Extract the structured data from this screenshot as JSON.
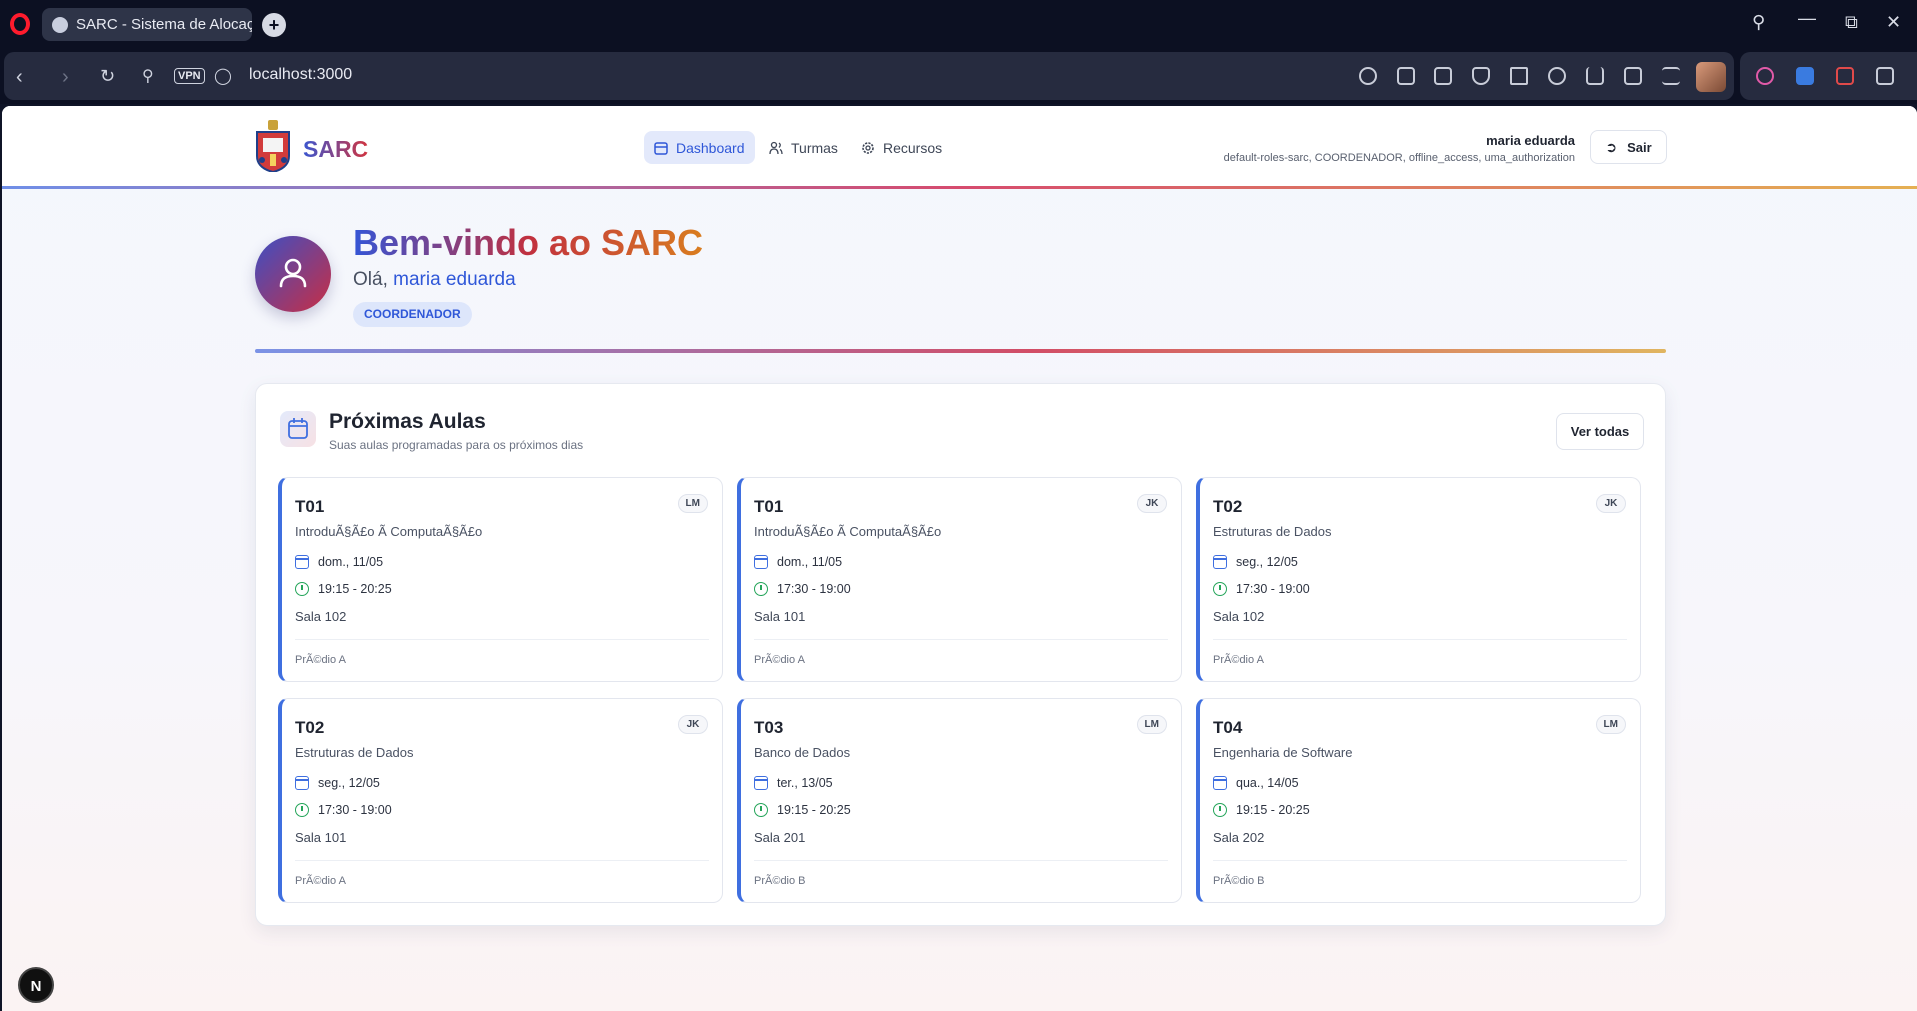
{
  "browser": {
    "tab_title": "SARC - Sistema de Alocaç",
    "url": "localhost:3000",
    "vpn_label": "VPN",
    "new_tab_label": "+"
  },
  "app": {
    "brand": "SARC",
    "nav": [
      {
        "label": "Dashboard",
        "icon": "calendar-icon",
        "active": true
      },
      {
        "label": "Turmas",
        "icon": "users-icon",
        "active": false
      },
      {
        "label": "Recursos",
        "icon": "gear-icon",
        "active": false
      }
    ],
    "user": {
      "name": "maria eduarda",
      "roles": "default-roles-sarc, COORDENADOR, offline_access, uma_authorization"
    },
    "logout_label": "Sair"
  },
  "hero": {
    "welcome": "Bem-vindo ao SARC",
    "greeting": "Olá,",
    "user_name": "maria eduarda",
    "role": "COORDENADOR"
  },
  "upcoming": {
    "title": "Próximas Aulas",
    "subtitle": "Suas aulas programadas para os próximos dias",
    "see_all": "Ver todas",
    "classes": [
      {
        "code": "T01",
        "prof": "LM",
        "course": "IntroduÃ§Ã£o Ã  ComputaÃ§Ã£o",
        "date": "dom., 11/05",
        "time": "19:15 - 20:25",
        "room": "Sala 102",
        "building": "PrÃ©dio A"
      },
      {
        "code": "T01",
        "prof": "JK",
        "course": "IntroduÃ§Ã£o Ã  ComputaÃ§Ã£o",
        "date": "dom., 11/05",
        "time": "17:30 - 19:00",
        "room": "Sala 101",
        "building": "PrÃ©dio A"
      },
      {
        "code": "T02",
        "prof": "JK",
        "course": "Estruturas de Dados",
        "date": "seg., 12/05",
        "time": "17:30 - 19:00",
        "room": "Sala 102",
        "building": "PrÃ©dio A"
      },
      {
        "code": "T02",
        "prof": "JK",
        "course": "Estruturas de Dados",
        "date": "seg., 12/05",
        "time": "17:30 - 19:00",
        "room": "Sala 101",
        "building": "PrÃ©dio A"
      },
      {
        "code": "T03",
        "prof": "LM",
        "course": "Banco de Dados",
        "date": "ter., 13/05",
        "time": "19:15 - 20:25",
        "room": "Sala 201",
        "building": "PrÃ©dio B"
      },
      {
        "code": "T04",
        "prof": "LM",
        "course": "Engenharia de Software",
        "date": "qua., 14/05",
        "time": "19:15 - 20:25",
        "room": "Sala 202",
        "building": "PrÃ©dio B"
      }
    ]
  },
  "dev_badge": "N"
}
